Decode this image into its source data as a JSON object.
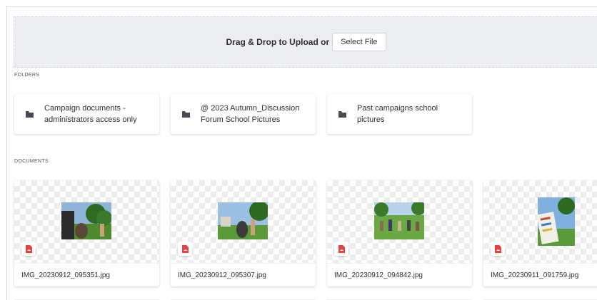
{
  "upload": {
    "prompt": "Drag & Drop to Upload or",
    "select_button": "Select File"
  },
  "sections": {
    "folders_label": "FOLDERS",
    "documents_label": "DOCUMENTS"
  },
  "folders": [
    {
      "line1": "Campaign documents -",
      "line2": "administrators access only",
      "icon": "folder-icon"
    },
    {
      "line1": "@ 2023 Autumn_Discussion",
      "line2": "Forum School Pictures",
      "icon": "folder-icon"
    },
    {
      "line1": "Past campaigns school",
      "line2": "pictures",
      "icon": "folder-icon"
    }
  ],
  "documents": [
    {
      "name": "IMG_20230912_095351.jpg",
      "icon": "image-file-icon"
    },
    {
      "name": "IMG_20230912_095307.jpg",
      "icon": "image-file-icon"
    },
    {
      "name": "IMG_20230912_094842.jpg",
      "icon": "image-file-icon"
    },
    {
      "name": "IMG_20230911_091759.jpg",
      "icon": "image-file-icon"
    }
  ],
  "colors": {
    "folder_icon": "#4a4a55",
    "file_badge": "#e8413f",
    "dropzone_bg": "#eceef2"
  }
}
